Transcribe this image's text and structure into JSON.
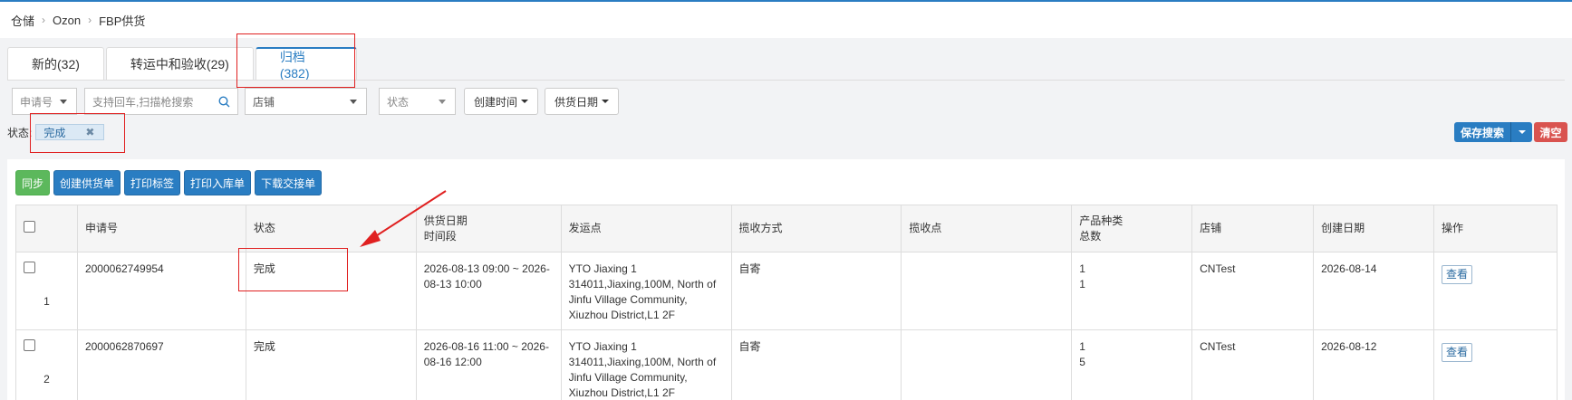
{
  "breadcrumb": [
    "仓储",
    "Ozon",
    "FBP供货"
  ],
  "tabs": [
    {
      "label": "新的(32)",
      "active": false
    },
    {
      "label": "转运中和验收(29)",
      "active": false
    },
    {
      "label": "归档(382)",
      "active": true
    }
  ],
  "filters": {
    "request_select": "申请号",
    "search_placeholder": "支持回车,扫描枪搜索",
    "shop_select": "店铺",
    "status_select": "状态",
    "created_time_button": "创建时间",
    "supply_date_button": "供货日期"
  },
  "status_filter": {
    "label": "状态:",
    "tag": "完成"
  },
  "save_search_label": "保存搜索",
  "clear_label": "清空",
  "actions": [
    "同步",
    "创建供货单",
    "打印标签",
    "打印入库单",
    "下载交接单"
  ],
  "table": {
    "headers": {
      "request_no": "申请号",
      "status": "状态",
      "supply_date_1": "供货日期",
      "supply_date_2": "时间段",
      "ship_from": "发运点",
      "pickup_method": "揽收方式",
      "pickup_point": "揽收点",
      "product_1": "产品种类",
      "product_2": "总数",
      "shop": "店铺",
      "created": "创建日期",
      "ops": "操作"
    },
    "rows": [
      {
        "index": "1",
        "request_no": "2000062749954",
        "status": "完成",
        "supply_date": "2026-08-13 09:00 ~ 2026-08-13 10:00",
        "ship_from": "YTO Jiaxing 1 314011,Jiaxing,100M, North of Jinfu Village Community, Xiuzhou District,L1 2F",
        "pickup_method": "自寄",
        "pickup_point": "",
        "kinds": "1",
        "total": "1",
        "shop": "CNTest",
        "created": "2026-08-14",
        "op": "查看"
      },
      {
        "index": "2",
        "request_no": "2000062870697",
        "status": "完成",
        "supply_date": "2026-08-16 11:00 ~ 2026-08-16 12:00",
        "ship_from": "YTO Jiaxing 1 314011,Jiaxing,100M, North of Jinfu Village Community, Xiuzhou District,L1 2F",
        "pickup_method": "自寄",
        "pickup_point": "",
        "kinds": "1",
        "total": "5",
        "shop": "CNTest",
        "created": "2026-08-12",
        "op": "查看"
      }
    ]
  },
  "colors": {
    "primary": "#2a7dc2",
    "danger": "#d9534f",
    "success": "#5cb85c",
    "annotation": "#e02020"
  }
}
